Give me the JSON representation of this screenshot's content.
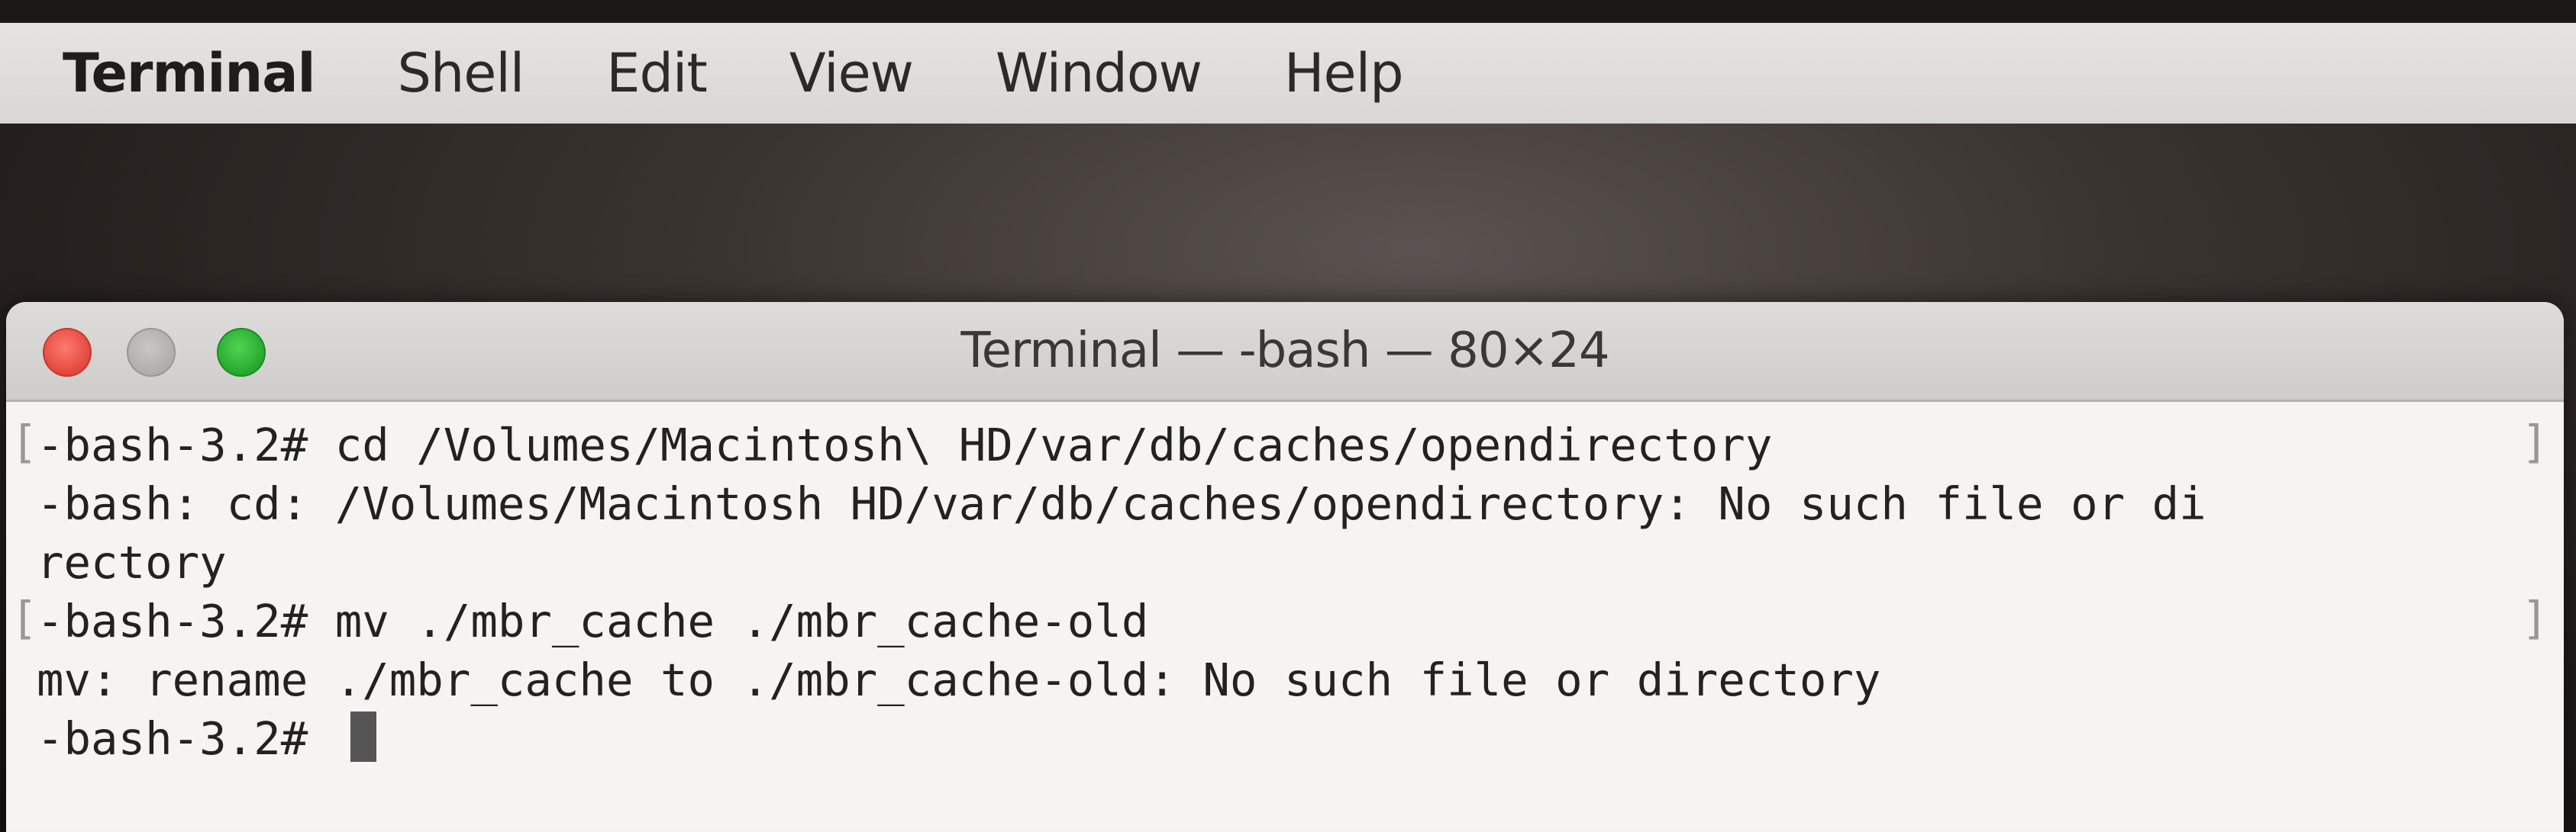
{
  "menubar": {
    "items": [
      "Terminal",
      "Shell",
      "Edit",
      "View",
      "Window",
      "Help"
    ]
  },
  "window": {
    "title": "Terminal — -bash — 80×24"
  },
  "terminal": {
    "lines": [
      "-bash-3.2# cd /Volumes/Macintosh\\ HD/var/db/caches/opendirectory",
      "-bash: cd: /Volumes/Macintosh HD/var/db/caches/opendirectory: No such file or di",
      "rectory",
      "-bash-3.2# mv ./mbr_cache ./mbr_cache-old",
      "mv: rename ./mbr_cache to ./mbr_cache-old: No such file or directory",
      "-bash-3.2# "
    ],
    "bracket_left": "[",
    "bracket_right": "]"
  },
  "icons": {
    "close": "close-icon",
    "minimize": "minimize-icon",
    "zoom": "zoom-icon",
    "cursor": "text-cursor"
  },
  "colors": {
    "close": "#e0443a",
    "minimize": "#aeaba8",
    "zoom": "#23a52c",
    "menubar": "#e0dedc",
    "terminal_bg": "#f5f4f2"
  }
}
